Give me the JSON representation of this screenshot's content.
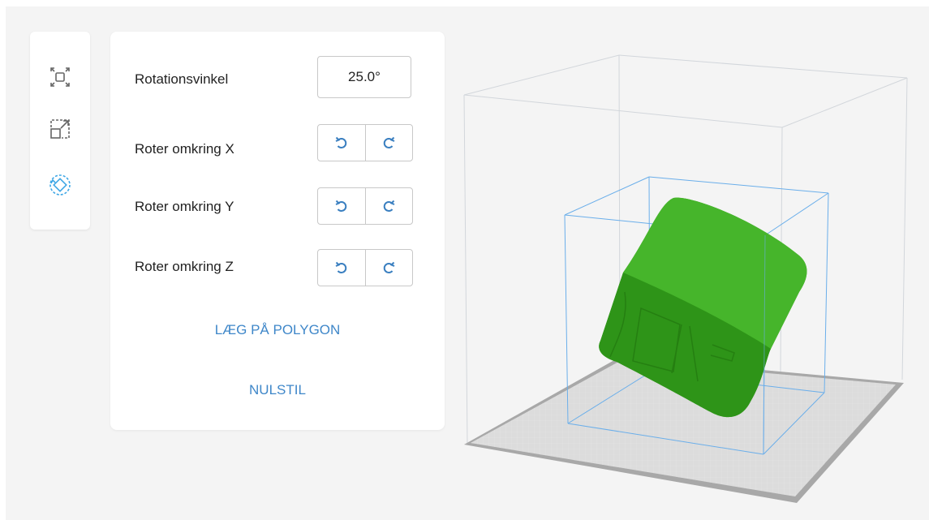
{
  "toolbar": {
    "tools": [
      {
        "name": "fit-view-icon",
        "active": false
      },
      {
        "name": "scale-icon",
        "active": false
      },
      {
        "name": "rotate-icon",
        "active": true
      }
    ]
  },
  "panel": {
    "angle_label": "Rotationsvinkel",
    "angle_value": "25.0°",
    "rotate_x_label": "Roter omkring X",
    "rotate_y_label": "Roter omkring Y",
    "rotate_z_label": "Roter omkring Z",
    "lay_flat_label": "LÆG PÅ POLYGON",
    "reset_label": "NULSTIL"
  },
  "colors": {
    "accent": "#3f87c9",
    "model": "#3aa021",
    "bounding_box": "#4a9ae0",
    "build_volume": "#cfd4da",
    "build_plate": "#d9d9d9"
  }
}
